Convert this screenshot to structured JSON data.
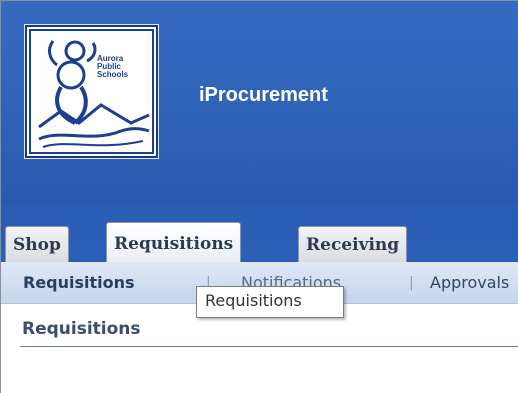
{
  "header": {
    "logo": {
      "line1": "Aurora",
      "line2": "Public",
      "line3": "Schools"
    },
    "app_title": "iProcurement"
  },
  "tabs": [
    {
      "label": "Shop"
    },
    {
      "label": "Requisitions",
      "active": true
    },
    {
      "label": "Receiving"
    }
  ],
  "subtabs": {
    "requisitions": "Requisitions",
    "separator": "|",
    "notifications": "Notifications",
    "approvals": "Approvals"
  },
  "tooltip": {
    "text": "Requisitions"
  },
  "page": {
    "heading": "Requisitions"
  },
  "colors": {
    "banner": "#2f63b8",
    "tab_text": "#2d3b4e",
    "logo_blue": "#1c3f8f"
  }
}
